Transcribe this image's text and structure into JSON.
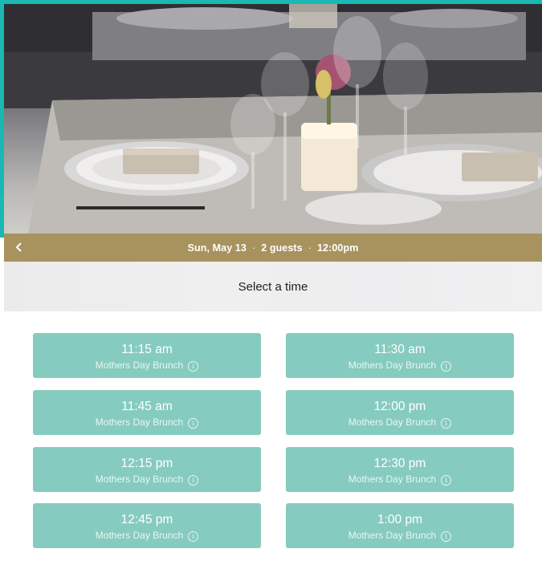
{
  "booking": {
    "date": "Sun, May 13",
    "guests": "2 guests",
    "time": "12:00pm",
    "separator": "·"
  },
  "heading": "Select a time",
  "colors": {
    "accent_teal": "#19b8b3",
    "header_gold": "#a8925e",
    "slot_bg": "#86cbbf"
  },
  "icons": {
    "back": "chevron-left-icon",
    "info": "info-icon"
  },
  "slots": [
    {
      "time": "11:15 am",
      "label": "Mothers Day Brunch",
      "info": "i"
    },
    {
      "time": "11:30 am",
      "label": "Mothers Day Brunch",
      "info": "i"
    },
    {
      "time": "11:45 am",
      "label": "Mothers Day Brunch",
      "info": "i"
    },
    {
      "time": "12:00 pm",
      "label": "Mothers Day Brunch",
      "info": "i"
    },
    {
      "time": "12:15 pm",
      "label": "Mothers Day Brunch",
      "info": "i"
    },
    {
      "time": "12:30 pm",
      "label": "Mothers Day Brunch",
      "info": "i"
    },
    {
      "time": "12:45 pm",
      "label": "Mothers Day Brunch",
      "info": "i"
    },
    {
      "time": "1:00 pm",
      "label": "Mothers Day Brunch",
      "info": "i"
    }
  ]
}
